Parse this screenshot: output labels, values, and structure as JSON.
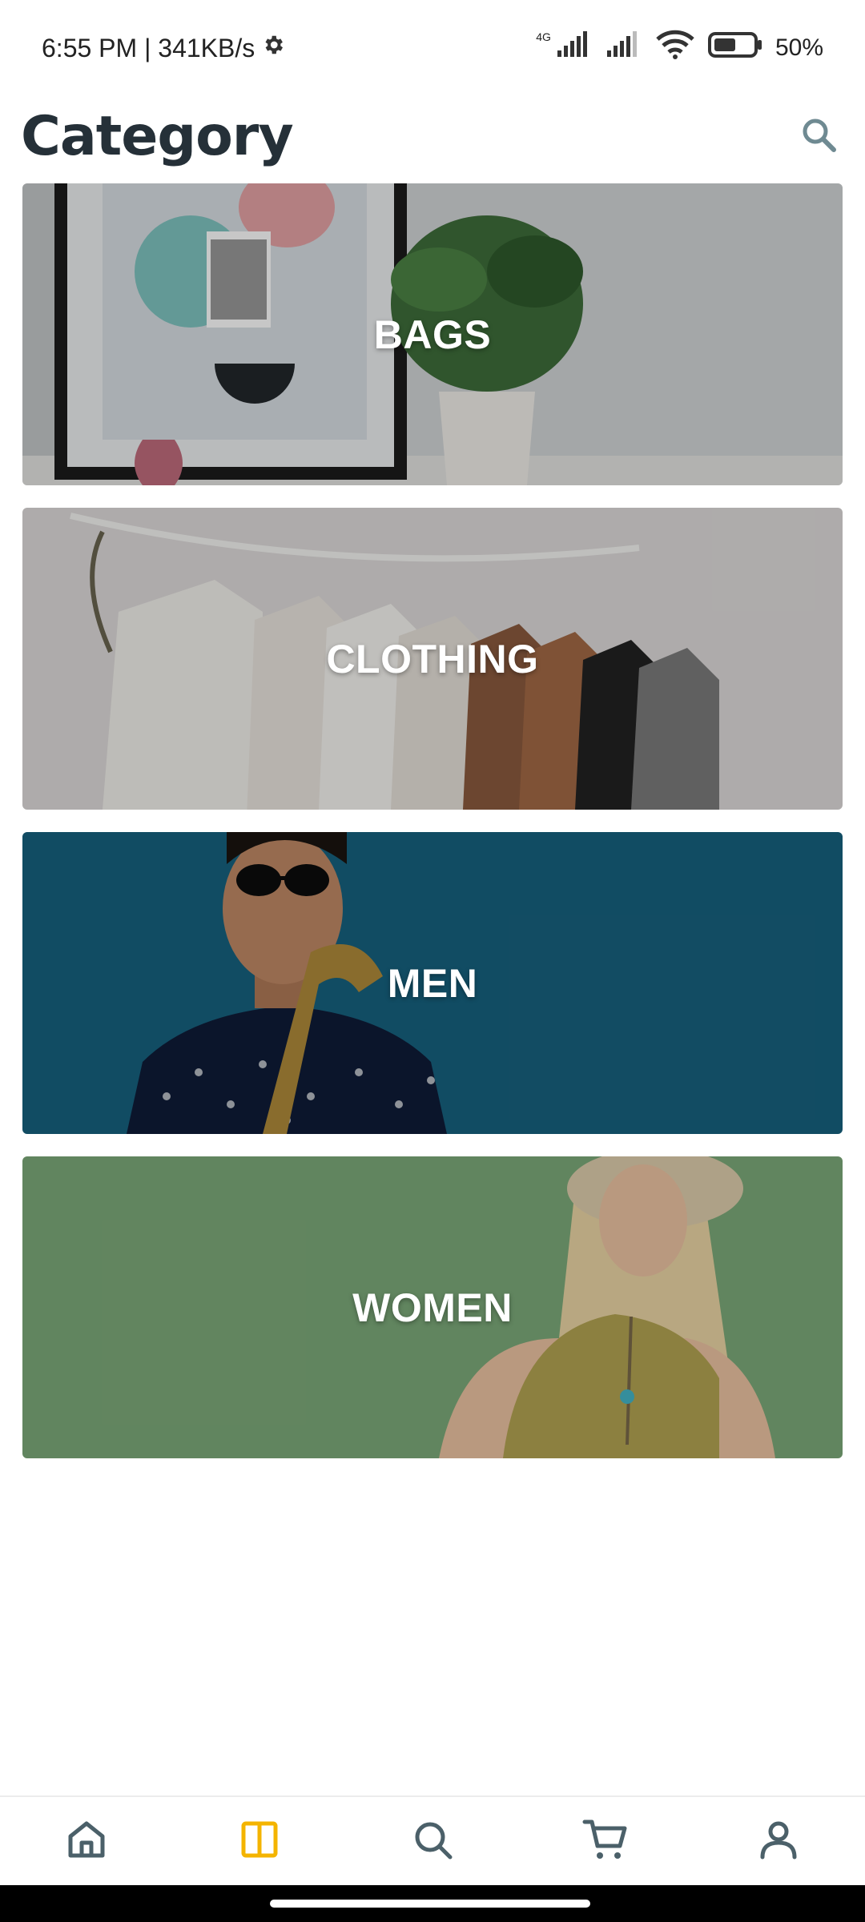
{
  "status": {
    "time_speed": "6:55 PM | 341KB/s",
    "network_label": "4G",
    "battery": "50%"
  },
  "header": {
    "title": "Category"
  },
  "categories": [
    {
      "label": "BAGS"
    },
    {
      "label": "CLOTHING"
    },
    {
      "label": "MEN"
    },
    {
      "label": "WOMEN"
    }
  ],
  "bottom_nav": {
    "active_index": 1,
    "active_color": "#f4b400",
    "items": [
      {
        "icon": "home-icon"
      },
      {
        "icon": "category-icon"
      },
      {
        "icon": "search-icon"
      },
      {
        "icon": "cart-icon"
      },
      {
        "icon": "profile-icon"
      }
    ]
  },
  "colors": {
    "title": "#253038",
    "men_bg": "#17627f",
    "women_bg": "#7dab7a"
  }
}
